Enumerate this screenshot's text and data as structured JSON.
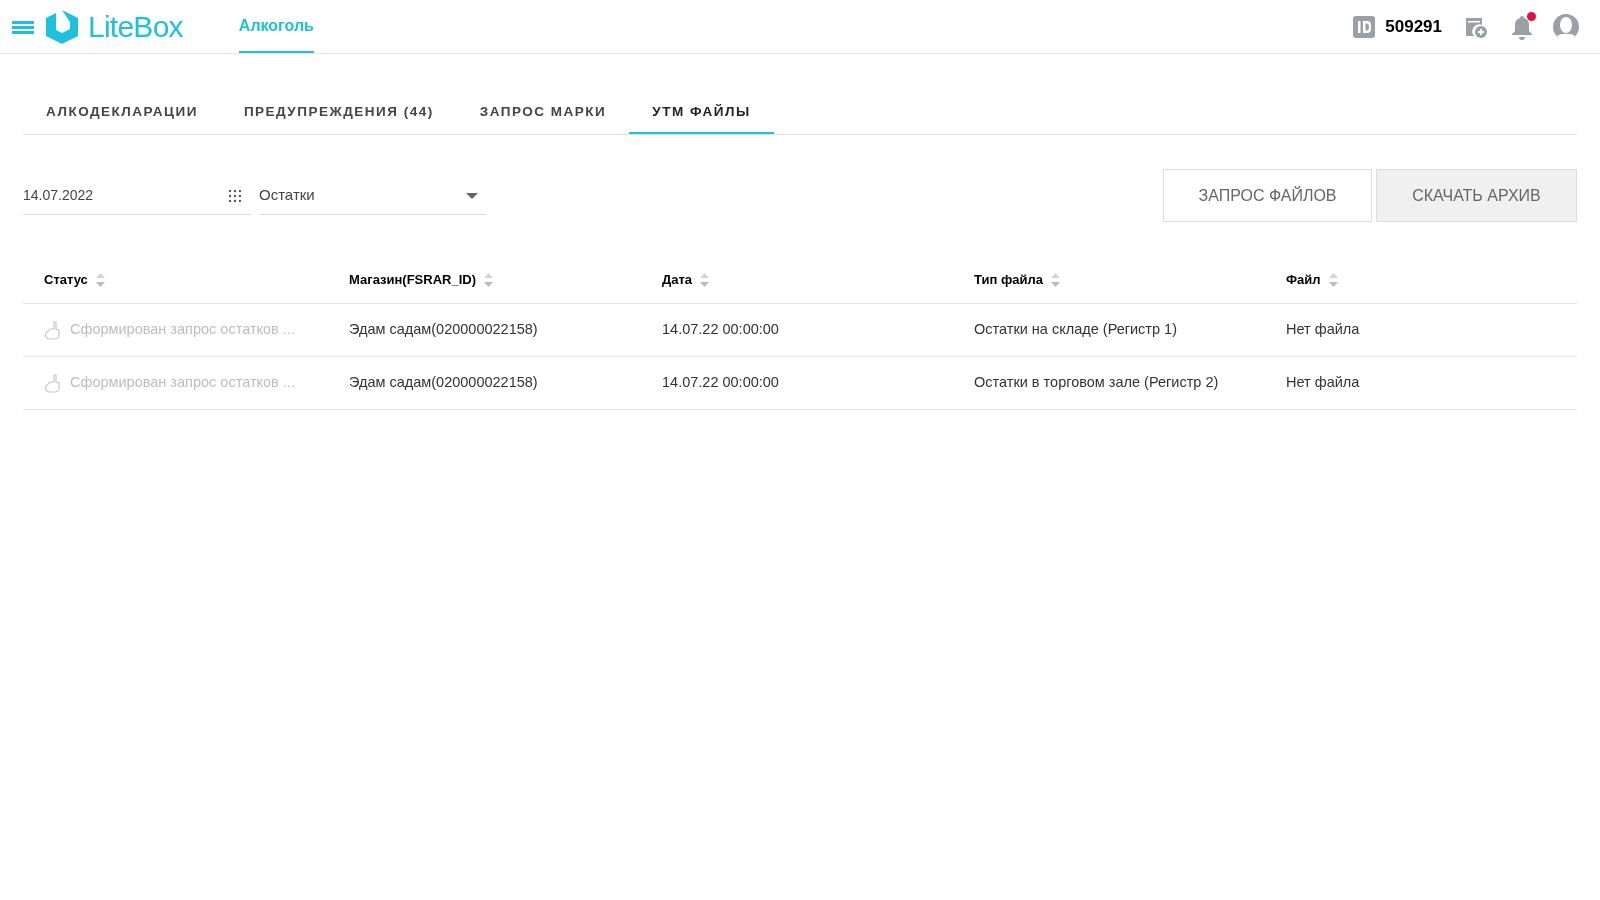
{
  "header": {
    "logo": "LiteBox",
    "nav": [
      {
        "label": "Алкоголь",
        "selected": true
      }
    ],
    "account_id": "509291",
    "notification_unread": true
  },
  "tabs": [
    {
      "label": "АЛКОДЕКЛАРАЦИИ",
      "selected": false
    },
    {
      "label": "ПРЕДУПРЕЖДЕНИЯ (44)",
      "selected": false
    },
    {
      "label": "ЗАПРОС МАРКИ",
      "selected": false
    },
    {
      "label": "УТМ ФАЙЛЫ",
      "selected": true
    }
  ],
  "filters": {
    "date": "14.07.2022",
    "type": "Остатки"
  },
  "buttons": [
    {
      "label": "ЗАПРОС ФАЙЛОВ",
      "disabled": false
    },
    {
      "label": "СКАЧАТЬ АРХИВ",
      "disabled": true
    }
  ],
  "table": {
    "columns": [
      "Статус",
      "Магазин(FSRAR_ID)",
      "Дата",
      "Тип файла",
      "Файл"
    ],
    "rows": [
      {
        "status": "Сформирован запрос остатков ...",
        "store": "Эдам садам(020000022158)",
        "date": "14.07.22 00:00:00",
        "file_type": "Остатки на складе (Регистр 1)",
        "file": "Нет файла"
      },
      {
        "status": "Сформирован запрос остатков ...",
        "store": "Эдам садам(020000022158)",
        "date": "14.07.22 00:00:00",
        "file_type": "Остатки в торговом зале (Регистр 2)",
        "file": "Нет файла"
      }
    ]
  }
}
